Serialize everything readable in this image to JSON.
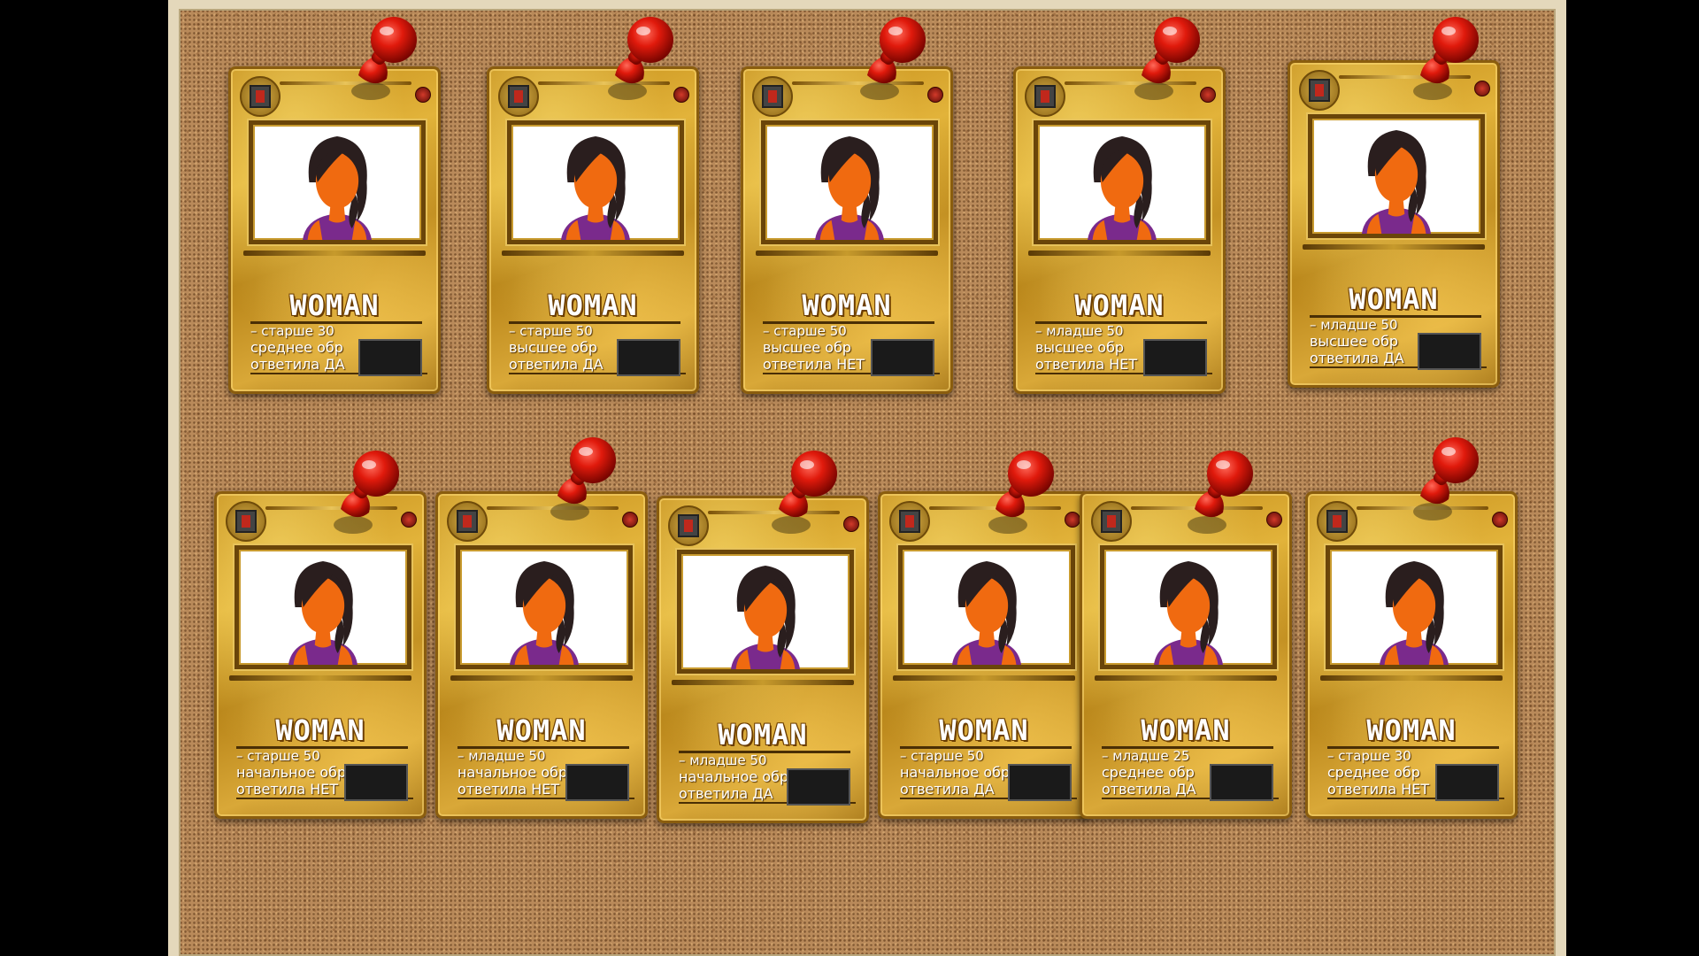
{
  "colors": {
    "board_frame": "#e4d8bb",
    "cork": "#b98a5a",
    "card_gold": "#d9a838",
    "pin_red": "#d8180c",
    "shirt_purple": "#7a2a8c",
    "face_orange": "#f06a10"
  },
  "icons": {
    "pin": "pushpin-icon",
    "badge": "faction-badge-icon",
    "cost": "cost-gem-icon"
  },
  "cards": [
    {
      "title": "WOMAN",
      "age": "старше 30",
      "education": "среднее обр",
      "answer": "ответила ДА"
    },
    {
      "title": "WOMAN",
      "age": "старше 50",
      "education": "высшее обр",
      "answer": "ответила ДА"
    },
    {
      "title": "WOMAN",
      "age": "старше 50",
      "education": "высшее обр",
      "answer": "ответила НЕТ"
    },
    {
      "title": "WOMAN",
      "age": "младше 50",
      "education": "высшее обр",
      "answer": "ответила НЕТ"
    },
    {
      "title": "WOMAN",
      "age": "младше 50",
      "education": "высшее обр",
      "answer": "ответила ДА"
    },
    {
      "title": "WOMAN",
      "age": "старше 50",
      "education": "начальное обр",
      "answer": "ответила НЕТ"
    },
    {
      "title": "WOMAN",
      "age": "младше 50",
      "education": "начальное обр",
      "answer": "ответила НЕТ"
    },
    {
      "title": "WOMAN",
      "age": "младше 50",
      "education": "начальное обр",
      "answer": "ответила ДА"
    },
    {
      "title": "WOMAN",
      "age": "старше 50",
      "education": "начальное обр",
      "answer": "ответила ДА"
    },
    {
      "title": "WOMAN",
      "age": "младше 25",
      "education": "среднее обр",
      "answer": "ответила ДА"
    },
    {
      "title": "WOMAN",
      "age": "старше 30",
      "education": "среднее обр",
      "answer": "ответила НЕТ"
    }
  ]
}
